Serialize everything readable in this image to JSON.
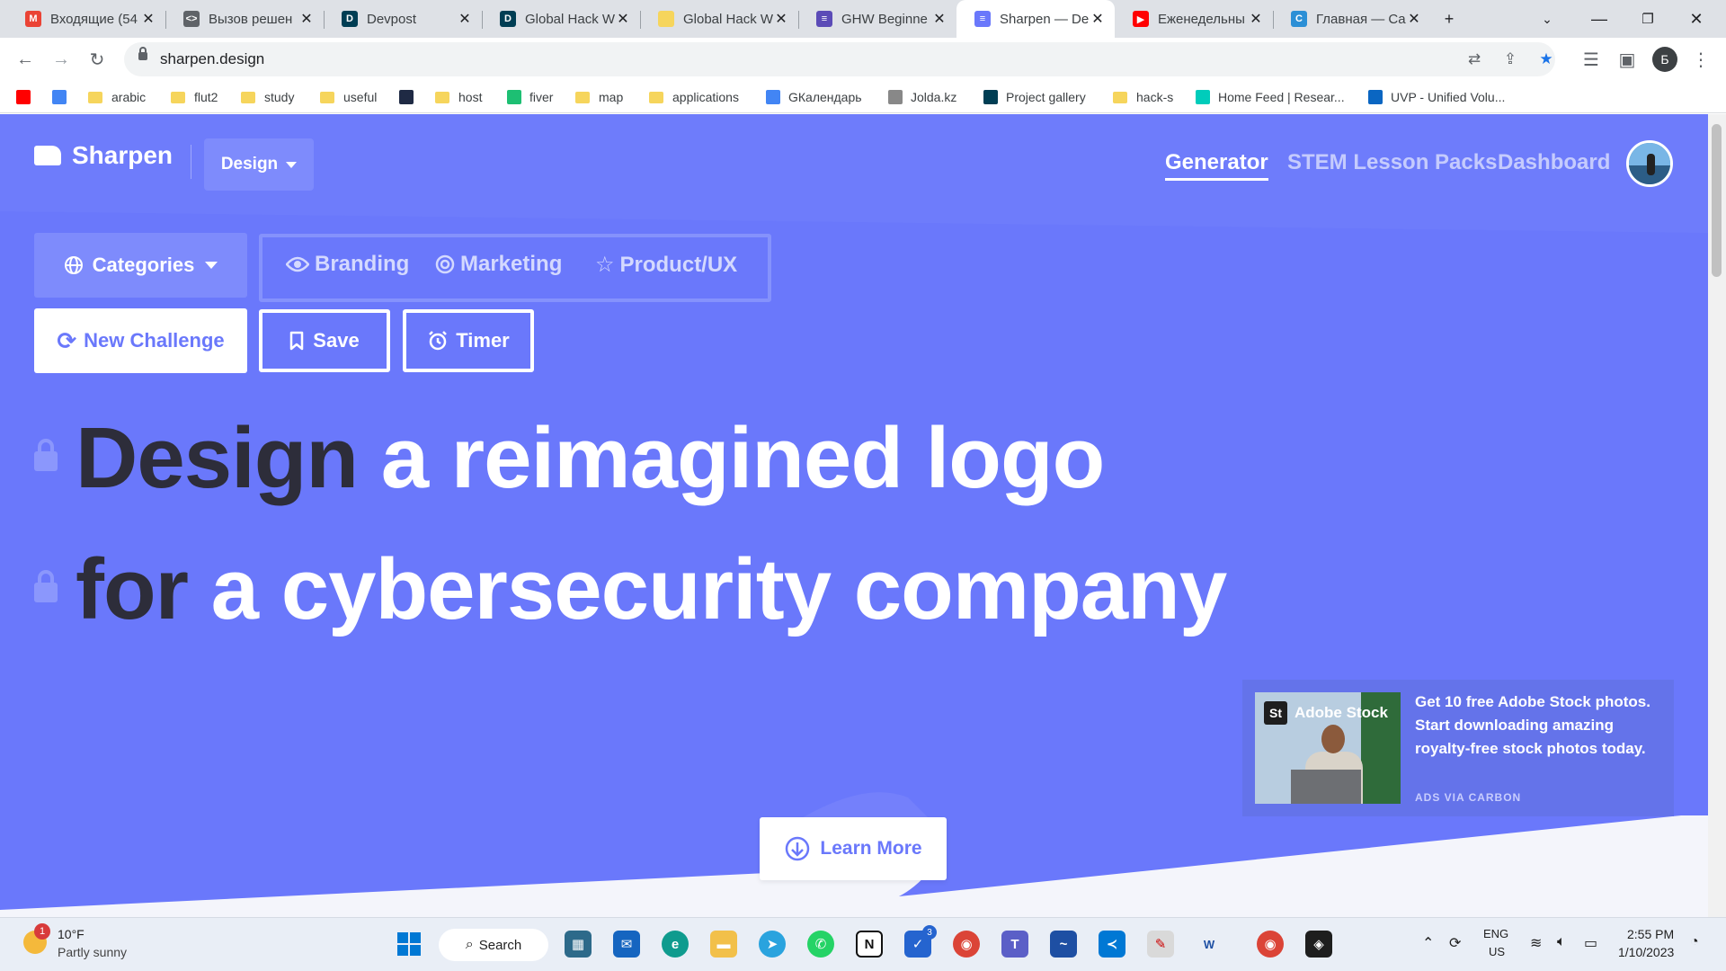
{
  "browser": {
    "tabs": [
      {
        "title": "Входящие (54",
        "icon": "gmail-icon",
        "color": "#ea4335",
        "glyph": "M"
      },
      {
        "title": "Вызов решен",
        "icon": "code-icon",
        "color": "#5f6368",
        "glyph": "<>"
      },
      {
        "title": "Devpost",
        "icon": "devpost-icon",
        "color": "#003e54",
        "glyph": "D"
      },
      {
        "title": "Global Hack W",
        "icon": "devpost-icon",
        "color": "#003e54",
        "glyph": "D"
      },
      {
        "title": "Global Hack W",
        "icon": "lightbulb-icon",
        "color": "#f6d55c",
        "glyph": ""
      },
      {
        "title": "GHW Beginne",
        "icon": "list-icon",
        "color": "#5b4bb7",
        "glyph": "≡"
      },
      {
        "title": "Sharpen — De",
        "icon": "sharpen-icon",
        "color": "#6a78fb",
        "glyph": "≡"
      },
      {
        "title": "Еженедельны",
        "icon": "youtube-icon",
        "color": "#ff0000",
        "glyph": "▶"
      },
      {
        "title": "Главная — Ca",
        "icon": "canva-icon",
        "color": "#2b8fd6",
        "glyph": "C"
      }
    ],
    "active_tab": 6,
    "new_tab": "+",
    "url": "sharpen.design",
    "profile_initial": "Б"
  },
  "bookmarks": [
    {
      "label": "",
      "icon": "youtube-icon",
      "kind": "icon",
      "color": "#ff0000"
    },
    {
      "label": "",
      "icon": "translate-icon",
      "kind": "icon",
      "color": "#4285f4"
    },
    {
      "label": "arabic",
      "kind": "folder"
    },
    {
      "label": "flut2",
      "kind": "folder"
    },
    {
      "label": "study",
      "kind": "folder"
    },
    {
      "label": "useful",
      "kind": "folder"
    },
    {
      "label": "",
      "icon": "bookmark-icon",
      "kind": "icon",
      "color": "#1f2a44"
    },
    {
      "label": "host",
      "kind": "folder"
    },
    {
      "label": "fiver",
      "icon": "fiverr-icon",
      "kind": "icon",
      "color": "#1dbf73"
    },
    {
      "label": "map",
      "kind": "folder"
    },
    {
      "label": "applications",
      "kind": "folder"
    },
    {
      "label": "GКалендарь",
      "icon": "calendar-icon",
      "kind": "icon",
      "color": "#4285f4"
    },
    {
      "label": "Jolda.kz",
      "icon": "jolda-icon",
      "kind": "icon",
      "color": "#888888"
    },
    {
      "label": "Project gallery",
      "icon": "devpost-icon",
      "kind": "icon",
      "color": "#003e54"
    },
    {
      "label": "hack-s",
      "kind": "folder"
    },
    {
      "label": "Home Feed | Resear...",
      "icon": "researchgate-icon",
      "kind": "icon",
      "color": "#00ccbb"
    },
    {
      "label": "UVP - Unified Volu...",
      "icon": "uvp-icon",
      "kind": "icon",
      "color": "#0a66c2"
    }
  ],
  "site": {
    "brand": "Sharpen",
    "mode_dropdown": "Design",
    "nav": [
      "Generator",
      "STEM Lesson Packs",
      "Dashboard"
    ],
    "active_nav": "Generator",
    "categories_label": "Categories",
    "tags": [
      {
        "label": "Branding",
        "icon": "eye-icon"
      },
      {
        "label": "Marketing",
        "icon": "target-icon"
      },
      {
        "label": "Product/UX",
        "icon": "star-icon"
      }
    ],
    "actions": {
      "new_challenge": "New Challenge",
      "save": "Save",
      "timer": "Timer"
    },
    "headline": {
      "line1_strong": "Design",
      "line1_rest": "a reimagined logo",
      "line2_strong": "for",
      "line2_rest": "a cybersecurity company"
    },
    "ad": {
      "brand": "Adobe Stock",
      "brand_badge": "St",
      "text": "Get 10 free Adobe Stock photos. Start downloading amazing royalty-free stock photos today.",
      "via": "ADS VIA CARBON"
    },
    "learn_more": "Learn More",
    "colors": {
      "primary": "#6a78fb",
      "dark_text": "#2d2d3a"
    }
  },
  "taskbar": {
    "weather_temp": "10°F",
    "weather_desc": "Partly sunny",
    "weather_badge": "1",
    "search_label": "Search",
    "todo_badge": "3",
    "lang": "ENG",
    "region": "US",
    "time": "2:55 PM",
    "date": "1/10/2023"
  }
}
